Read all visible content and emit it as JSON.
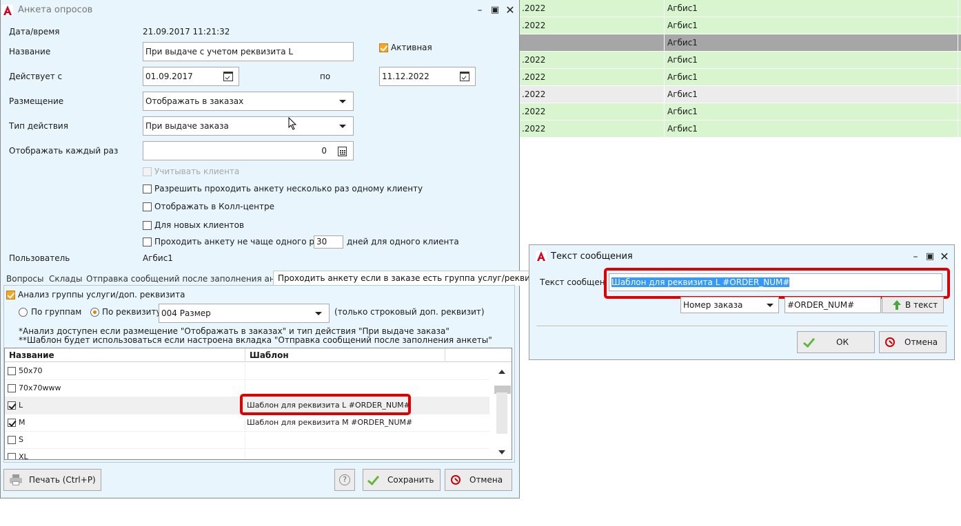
{
  "background_grid": {
    "rows": [
      {
        "date": ".2022",
        "user": "Агбис1",
        "style": "green"
      },
      {
        "date": ".2022",
        "user": "Агбис1",
        "style": "green"
      },
      {
        "date": "",
        "user": "Агбис1",
        "style": "gray"
      },
      {
        "date": ".2022",
        "user": "Агбис1",
        "style": "green"
      },
      {
        "date": ".2022",
        "user": "Агбис1",
        "style": "green"
      },
      {
        "date": ".2022",
        "user": "Агбис1",
        "style": "lgray"
      },
      {
        "date": ".2022",
        "user": "Агбис1",
        "style": "green"
      },
      {
        "date": ".2022",
        "user": "Агбис1",
        "style": "green"
      }
    ]
  },
  "main_window": {
    "title": "Анкета опросов",
    "datetime_label": "Дата/время",
    "datetime_value": "21.09.2017 11:21:32",
    "name_label": "Название",
    "name_value": "При выдаче с учетом реквизита L",
    "active_label": "Активная",
    "valid_from_label": "Действует с",
    "valid_from_value": "01.09.2017",
    "valid_to_label": "по",
    "valid_to_value": "11.12.2022",
    "placement_label": "Размещение",
    "placement_value": "Отображать в заказах",
    "action_type_label": "Тип действия",
    "action_type_value": "При выдаче заказа",
    "show_each_label": "Отображать каждый раз",
    "show_each_value": "0",
    "consider_client_label": "Учитывать клиента",
    "allow_multiple_label": "Разрешить проходить анкету несколько раз одному клиенту",
    "show_callcenter_label": "Отображать в Колл-центре",
    "new_clients_label": "Для новых клиентов",
    "not_often_label": "Проходить анкету не чаще одного раза в",
    "not_often_value": "30",
    "not_often_suffix": "дней для одного клиента",
    "user_label": "Пользователь",
    "user_value": "Агбис1",
    "tabs": [
      {
        "label": "Вопросы"
      },
      {
        "label": "Склады"
      },
      {
        "label": "Отправка сообщений после заполнения анкеты"
      },
      {
        "label": "Проходить анкету если в заказе есть группа услуг/реквизит"
      }
    ],
    "tab_panel": {
      "analysis_label": "Анализ группы услуги/доп. реквизита",
      "by_groups_label": "По группам",
      "by_attribute_label": "По реквизиту",
      "attribute_value": "004 Размер",
      "attribute_note": "(только строковый доп. реквизит)",
      "note1": "*Анализ доступен если размещение  \"Отображать в заказах\" и тип действия \"При выдаче заказа\"",
      "note2": "**Шаблон будет использоваться если настроена вкладка \"Отправка сообщений после заполнения анкеты\"",
      "grid": {
        "headers": {
          "name": "Название",
          "template": "Шаблон"
        },
        "rows": [
          {
            "name": "50x70",
            "template": "",
            "checked": false
          },
          {
            "name": "70x70www",
            "template": "",
            "checked": false
          },
          {
            "name": "L",
            "template": "Шаблон для реквизита L #ORDER_NUM#",
            "checked": true
          },
          {
            "name": "M",
            "template": "Шаблон для реквизита M #ORDER_NUM#",
            "checked": true
          },
          {
            "name": "S",
            "template": "",
            "checked": false
          },
          {
            "name": "XL",
            "template": "",
            "checked": false
          }
        ]
      }
    },
    "buttons": {
      "print": "Печать (Ctrl+P)",
      "help": "?",
      "save": "Сохранить",
      "cancel": "Отмена"
    }
  },
  "message_dialog": {
    "title": "Текст сообщения",
    "text_label": "Текст сообщения",
    "text_value": "Шаблон для реквизита L #ORDER_NUM#",
    "field_select_value": "Номер заказа",
    "field_code_value": "#ORDER_NUM#",
    "to_text_button": "В текст",
    "ok_button": "ОК",
    "cancel_button": "Отмена"
  },
  "colors": {
    "highlight_red": "#e00000",
    "row_green": "#d8f5cf",
    "window_bg": "#e8f5fc",
    "selection_blue": "#3399ff",
    "radio_orange": "#e67e00",
    "checkbox_orange": "#f5a623"
  }
}
